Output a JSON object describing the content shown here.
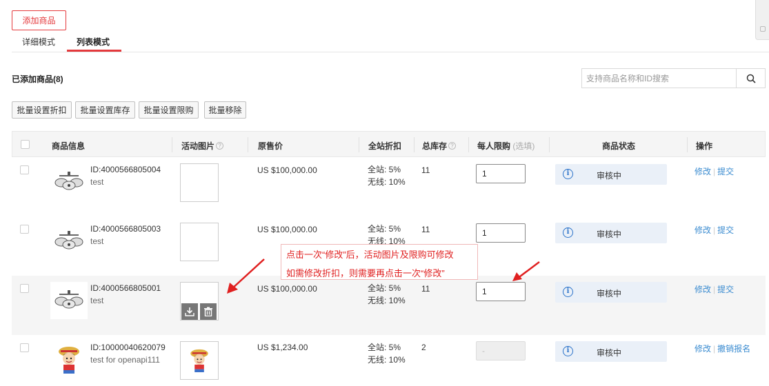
{
  "toolbar": {
    "add_label": "添加商品"
  },
  "tabs": [
    {
      "label": "详细模式"
    },
    {
      "label": "列表模式"
    }
  ],
  "section": {
    "count_title": "已添加商品(8)"
  },
  "search": {
    "placeholder": "支持商品名称和ID搜索"
  },
  "batch": [
    {
      "label": "批量设置折扣"
    },
    {
      "label": "批量设置库存"
    },
    {
      "label": "批量设置限购"
    },
    {
      "label": "批量移除"
    }
  ],
  "headers": {
    "info": "商品信息",
    "image": "活动图片",
    "price": "原售价",
    "discount": "全站折扣",
    "stock": "总库存",
    "limit": "每人限购",
    "limit_hint": "(选填)",
    "status": "商品状态",
    "ops": "操作"
  },
  "rows": [
    {
      "id": "ID:4000566805004",
      "name": "test",
      "price": "US $100,000.00",
      "disc1": "全站: 5%",
      "disc2": "无线: 10%",
      "stock": "11",
      "limit": "1",
      "status": "审核中",
      "op1": "修改",
      "op2": "提交"
    },
    {
      "id": "ID:4000566805003",
      "name": "test",
      "price": "US $100,000.00",
      "disc1": "全站: 5%",
      "disc2": "无线: 10%",
      "stock": "11",
      "limit": "1",
      "status": "审核中",
      "op1": "修改",
      "op2": "提交"
    },
    {
      "id": "ID:4000566805001",
      "name": "test",
      "price": "US $100,000.00",
      "disc1": "全站: 5%",
      "disc2": "无线: 10%",
      "stock": "11",
      "limit": "1",
      "status": "审核中",
      "op1": "修改",
      "op2": "提交"
    },
    {
      "id": "ID:10000040620079",
      "name": "test for openapi111",
      "price": "US $1,234.00",
      "disc1": "全站: 5%",
      "disc2": "无线: 10%",
      "stock": "2",
      "limit": "-",
      "status": "审核中",
      "op1": "修改",
      "op2": "撤销报名"
    }
  ],
  "annotation": {
    "line1": "点击一次“修改”后，活动图片及限购可修改",
    "line2": "如需修改折扣，则需要再点击一次“修改”"
  },
  "icons": {
    "search": "search-icon",
    "info": "info-icon",
    "help": "question-icon",
    "download": "download-icon",
    "trash": "trash-icon",
    "product_drone": "drone-icon",
    "product_cartoon": "cartoon-character-icon"
  },
  "colors": {
    "accent": "#e4393c",
    "link": "#3a8bd0",
    "status_bg": "#eaf0f8",
    "annotation": "#e02020"
  }
}
